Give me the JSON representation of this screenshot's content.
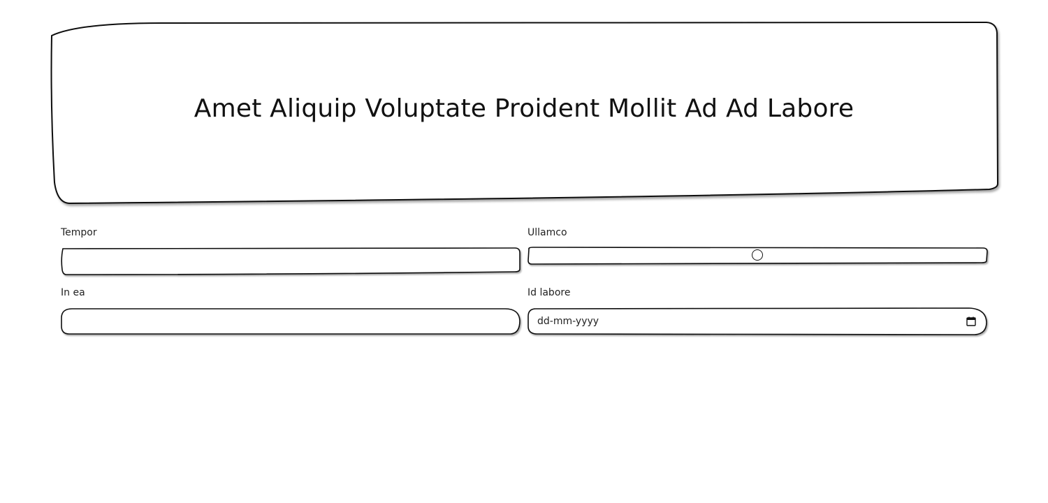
{
  "hero": {
    "title": "Amet Aliquip Voluptate Proident Mollit Ad Ad Labore"
  },
  "form": {
    "tempor": {
      "label": "Tempor",
      "value": ""
    },
    "ullamco": {
      "label": "Ullamco",
      "value": 0.5
    },
    "in_ea": {
      "label": "In ea",
      "value": ""
    },
    "id_labore": {
      "label": "Id labore",
      "placeholder": "dd-mm-yyyy"
    }
  },
  "icons": {
    "calendar": "calendar-icon"
  }
}
